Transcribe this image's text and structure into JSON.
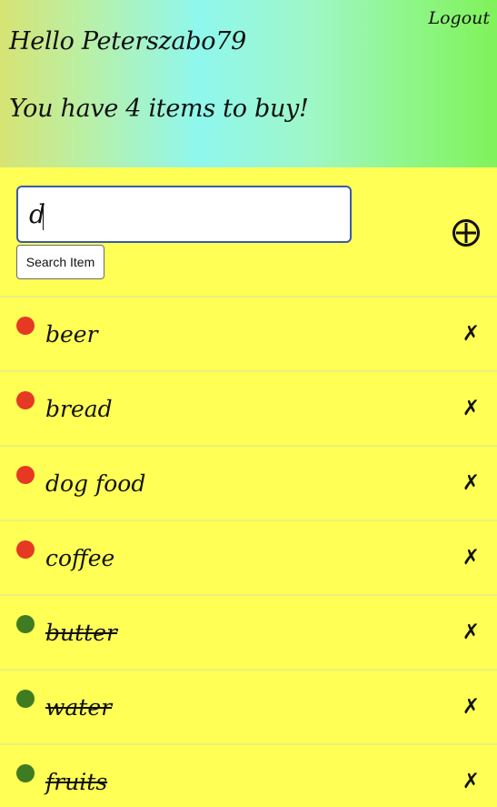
{
  "header": {
    "logout_label": "Logout",
    "greeting": "Hello Peterszabo79",
    "todo_count": "You have 4 items to buy!"
  },
  "search": {
    "value": "d",
    "button_label": "Search Item",
    "add_icon": "circled-plus-icon"
  },
  "colors": {
    "pending": "#e53924",
    "done": "#3f7b20"
  },
  "items": [
    {
      "label": "beer",
      "status": "pending",
      "remove_icon": "✗"
    },
    {
      "label": "bread",
      "status": "pending",
      "remove_icon": "✗"
    },
    {
      "label": "dog food",
      "status": "pending",
      "remove_icon": "✗"
    },
    {
      "label": "coffee",
      "status": "pending",
      "remove_icon": "✗"
    },
    {
      "label": "butter",
      "status": "done",
      "remove_icon": "✗"
    },
    {
      "label": "water",
      "status": "done",
      "remove_icon": "✗"
    },
    {
      "label": "fruits",
      "status": "done",
      "remove_icon": "✗"
    }
  ]
}
